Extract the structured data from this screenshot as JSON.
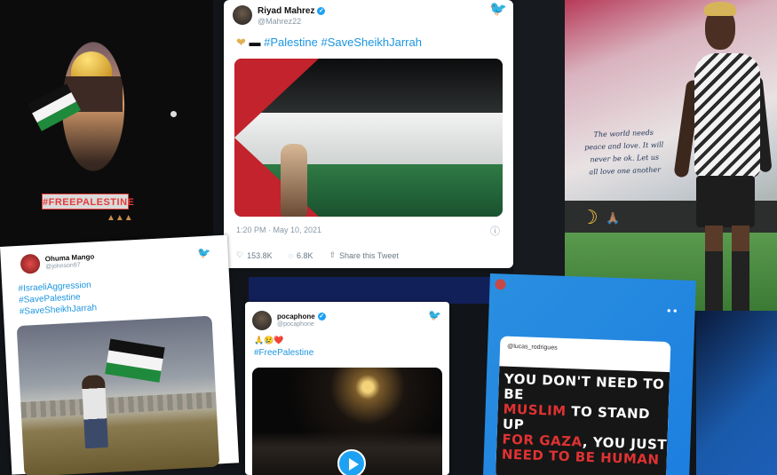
{
  "story_left": {
    "tag": "#FREEPALESTINE",
    "emoji_row": "▲▲▲"
  },
  "tweet_main": {
    "name": "Riyad Mahrez",
    "handle": "@Mahrez22",
    "text": "#Palestine #SaveSheikhJarrah",
    "timestamp": "1:20 PM · May 10, 2021",
    "likes": "153.8K",
    "replies": "6.8K",
    "share_label": "Share this Tweet"
  },
  "story_right": {
    "quote": "The world needs peace and love. It will never be ok. Let us all love one another",
    "moon": "☽",
    "hearts": "🙏🏽"
  },
  "tweet_bottom_left": {
    "name": "Ohuma Mango",
    "handle": "@johnson97",
    "hashtags": [
      "#IsraeliAggression",
      "#SavePalestine",
      "#SaveSheikhJarrah"
    ]
  },
  "tweet_video": {
    "name": "pocaphone",
    "handle": "@pocaphone",
    "emojis": "🙏😢❤️",
    "text": "#FreePalestine"
  },
  "story_blue": {
    "card_user": "@lucas_rodrigues",
    "line1": "YOU DON'T NEED TO BE",
    "line2_red": "MUSLIM",
    "line2": " TO STAND UP",
    "line3_red": "FOR GAZA",
    "line3": ", YOU JUST",
    "line4_red": "NEED TO BE HUMAN"
  },
  "colors": {
    "twitter_blue": "#1da1f2",
    "flag_black": "#0c0d0e",
    "flag_white": "#f2f2f2",
    "flag_green": "#2f7a44",
    "flag_red": "#c2232c"
  }
}
